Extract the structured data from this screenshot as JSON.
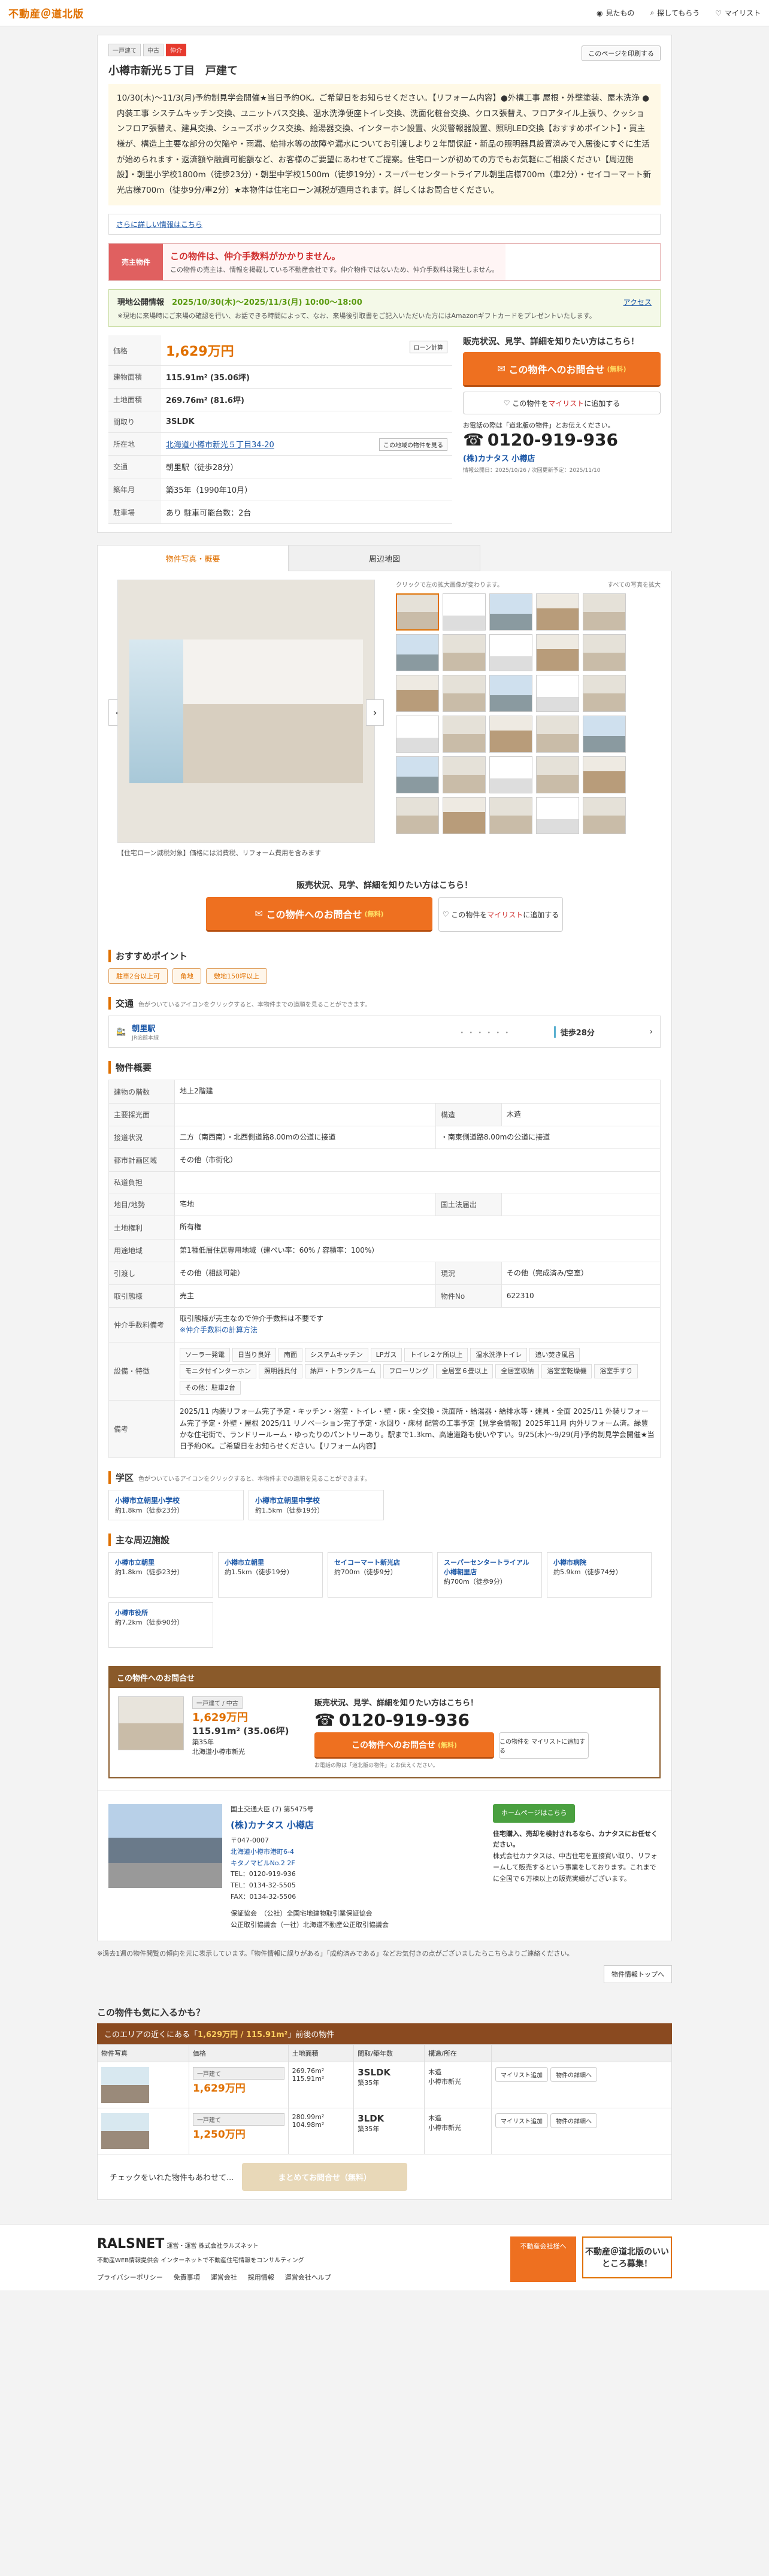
{
  "header": {
    "logo": "不動産＠道北版",
    "nav": [
      "見たもの",
      "探してもらう",
      "マイリスト"
    ]
  },
  "property": {
    "tags": [
      "一戸建て",
      "中古",
      "仲介"
    ],
    "copy_btn": "このページを印刷する",
    "title": "小樽市新光５丁目　戸建て",
    "intro": "10/30(木)〜11/3(月)予約制見学会開催★当日予約OK。ご希望日をお知らせください。【リフォーム内容】●外構工事 屋根・外壁塗装、屋木洗浄 ●内装工事 システムキッチン交換、ユニットバス交換、温水洗浄便座トイレ交換、洗面化粧台交換、クロス張替え、フロアタイル上張り、クッションフロア張替え、建具交換、シューズボックス交換、給湯器交換、インターホン設置、火災警報器設置、照明LED交換【おすすめポイント】・買主様が、構造上主要な部分の欠陥や・雨漏、給排水等の故障や漏水についてお引渡しより２年間保証・新品の照明器具設置済みで入居後にすぐに生活が始められます・返済額や融資可能額など、お客様のご要望にあわせてご提案。住宅ローンが初めての方でもお気軽にご相談ください【周辺施設】・朝里小学校1800m（徒歩23分）・朝里中学校1500m（徒歩19分）・スーパーセンタートライアル朝里店様700m（車2分）・セイコーマート新光店様700m（徒歩9分/車2分）★本物件は住宅ローン減税が適用されます。詳しくはお問合せください。",
    "more_link": "さらに詳しい情報はこちら",
    "notice_label": "売主物件",
    "notice_t1": "この物件は、仲介手数料がかかりません。",
    "notice_t2": "この物件の売主は、情報を掲載している不動産会社です。仲介物件ではないため、仲介手数料は発生しません。",
    "openhouse_t1a": "現地公開情報",
    "openhouse_t1b": "2025/10/30(木)〜2025/11/3(月) 10:00〜18:00",
    "openhouse_t2": "※現地に来場時にご来場の確認を行い、お話できる時間によって、なお、来場後引取書をご記入いただいた方にはAmazonギフトカードをプレゼントいたします。",
    "openhouse_access": "アクセス",
    "specs": {
      "price_label": "価格",
      "price": "1,629万円",
      "loan_btn": "ローン計算",
      "building_label": "建物面積",
      "building": "115.91m² (35.06坪)",
      "land_label": "土地面積",
      "land": "269.76m² (81.6坪)",
      "layout_label": "間取り",
      "layout": "3SLDK",
      "addr_label": "所在地",
      "addr": "北海道小樽市新光５丁目34-20",
      "map_btn": "この地域の物件を見る",
      "traffic_label": "交通",
      "traffic": "朝里駅（徒歩28分）",
      "age_label": "築年月",
      "age": "築35年（1990年10月）",
      "parking_label": "駐車場",
      "parking": "あり 駐車可能台数：2台"
    }
  },
  "cta": {
    "title": "販売状況、見学、詳細を知りたい方はこちら！",
    "inquiry": "この物件へのお問合せ",
    "free": "(無料)",
    "watch_pre": "この物件を",
    "watch_hl": "マイリスト",
    "watch_post": "に追加する",
    "tel_note": "お電話の際は「道北版の物件」とお伝えください。",
    "tel": "0120-919-936",
    "company": "(株)カナタス 小樽店",
    "update": "情報公開日：2025/10/26 / 次回更新予定：2025/11/10"
  },
  "tabs": [
    "物件写真・概要",
    "周辺地図"
  ],
  "photos": {
    "hint": "クリックで左の拡大画像が変わります。",
    "expand": "すべての写真を拡大",
    "caption": "【住宅ローン減税対象】価格には消費税、リフォーム費用を含みます"
  },
  "points": {
    "title": "おすすめポイント",
    "items": [
      "駐車2台以上可",
      "角地",
      "敷地150坪以上"
    ]
  },
  "transport": {
    "title": "交通",
    "note": "色がついているアイコンをクリックすると、本物件までの道順を見ることができます。",
    "station": "朝里駅",
    "line": "JR函館本線",
    "walk": "徒歩28分"
  },
  "overview": {
    "title": "物件概要",
    "rows": [
      [
        "建物の階数",
        "地上2階建"
      ],
      [
        "主要採光面",
        ""
      ],
      [
        "構造",
        "木造"
      ],
      [
        "接道状況",
        "二方（南西南）・北西側道路8.00mの公道に接道"
      ],
      [
        "接道2",
        "・南東側道路8.00mの公道に接道"
      ],
      [
        "都市計画区域",
        "その他（市街化）"
      ],
      [
        "私道負担",
        ""
      ],
      [
        "地目/地勢",
        "宅地"
      ],
      [
        "国土法届出",
        ""
      ],
      [
        "土地権利",
        "所有権"
      ],
      [
        "用途地域",
        "第1種低層住居専用地域（建ぺい率：60% / 容積率：100%）"
      ],
      [
        "引渡し",
        "その他（相談可能）"
      ],
      [
        "現況",
        "その他（完成済み/空室）"
      ],
      [
        "取引態様",
        "売主"
      ],
      [
        "物件No",
        "622310"
      ],
      [
        "仲介手数料備考",
        "取引態様が売主なので仲介手数料は不要です"
      ],
      [
        "仲介手数料link",
        "※仲介手数料の計算方法"
      ],
      [
        "設備・特徴",
        ""
      ],
      [
        "備考",
        "2025/11 内装リフォーム完了予定・キッチン・浴室・トイレ・壁・床・全交換・洗面所・給湯器・給排水等・建具・全面 2025/11 外装リフォーム完了予定・外壁・屋根 2025/11 リノベーション完了予定・水回り・床材 配管の工事予定【見学会情報】2025年11月 内外リフォーム済。緑豊かな住宅街で、ランドリールーム・ゆったりのパントリーあり。駅まで1.3km、高速道路も使いやすい。9/25(木)〜9/29(月)予約制見学会開催★当日予約OK。ご希望日をお知らせください。【リフォーム内容】"
      ]
    ],
    "equip": [
      "ソーラー発電",
      "日当り良好",
      "南面",
      "システムキッチン",
      "LPガス",
      "トイレ２ケ所以上",
      "温水洗浄トイレ",
      "追い焚き風呂",
      "モニタ付インターホン",
      "照明器具付",
      "納戸・トランクルーム",
      "フローリング",
      "全居室６畳以上",
      "全居室収納",
      "浴室室乾燥機",
      "浴室手すり",
      "その他：駐車2台"
    ]
  },
  "schools": {
    "title": "学区",
    "note": "色がついているアイコンをクリックすると、本物件までの道順を見ることができます。",
    "items": [
      {
        "name": "小樽市立朝里小学校",
        "dist": "約1.8km（徒歩23分）"
      },
      {
        "name": "小樽市立朝里中学校",
        "dist": "約1.5km（徒歩19分）"
      }
    ]
  },
  "facilities": {
    "title": "主な周辺施設",
    "items": [
      {
        "name": "小樽市立朝里",
        "dist": "約1.8km（徒歩23分）"
      },
      {
        "name": "小樽市立朝里",
        "dist": "約1.5km（徒歩19分）"
      },
      {
        "name": "セイコーマート新光店",
        "dist": "約700m（徒歩9分）"
      },
      {
        "name": "スーパーセンタートライアル小樽朝里店",
        "dist": "約700m（徒歩9分）"
      },
      {
        "name": "小樽市病院",
        "dist": "約5.9km（徒歩74分）"
      },
      {
        "name": "小樽市役所",
        "dist": "約7.2km（徒歩90分）"
      }
    ]
  },
  "inquiry": {
    "head": "この物件へのお問合せ",
    "tag": "一戸建て / 中古",
    "price": "1,629万円",
    "area": "115.91m² (35.06坪)",
    "age": "築35年",
    "addr": "北海道小樽市新光",
    "ttl": "販売状況、見学、詳細を知りたい方はこちら！",
    "tel": "0120-919-936",
    "tel_note": "お電話の際は「道北版の物件」とお伝えください。",
    "btn": "この物件へのお問合せ",
    "free": "(無料)",
    "watch": "この物件を マイリストに追加する"
  },
  "agent": {
    "license": "国土交通大臣 (7) 第5475号",
    "name": "(株)カナタス 小樽店",
    "hp": "ホームページはこちら",
    "info": [
      "〒047-0007",
      "北海道小樽市港町6-4",
      "キタノマビルNo.2 2F",
      "TEL：0120-919-936",
      "TEL：0134-32-5505",
      "FAX：0134-32-5506"
    ],
    "desc_h": "住宅購入、売却を検討されるなら、カナタスにお任せください。",
    "desc": "株式会社カナタスは、中古住宅を直接買い取り、リフォームして販売するという事業をしております。これまでに全国で６万棟以上の販売実績がございます。",
    "assoc": [
      "保証協会　（公社）全国宅地建物取引業保証協会",
      "公正取引協議会（一社）北海道不動産公正取引協議会"
    ]
  },
  "footnote": "※過去1週の物件閲覧の傾向を元に表示しています。「物件情報に誤りがある」「成約済みである」などお気付きの点がございましたらこちらよりご連絡ください。",
  "pagetop": "物件情報トップへ",
  "similar": {
    "title": "この物件も気に入るかも？",
    "bar_pre": "このエリアの近くにある「",
    "bar_b": "1,629万円 / 115.91m²",
    "bar_post": "」前後の物件",
    "cols": [
      "物件写真",
      "価格",
      "土地面積",
      "間取/築年数",
      "構造/所在",
      ""
    ],
    "rows": [
      {
        "tag": "一戸建て",
        "price": "1,629万円",
        "land": "269.76m²",
        "bld": "115.91m²",
        "layout": "3SLDK",
        "age": "築35年",
        "struct": "木造",
        "loc": "小樽市新光",
        "btn1": "マイリスト追加",
        "btn2": "物件の詳細へ"
      },
      {
        "tag": "一戸建て",
        "price": "1,250万円",
        "land": "280.99m²",
        "bld": "104.98m²",
        "layout": "3LDK",
        "age": "築35年",
        "struct": "木造",
        "loc": "小樽市新光",
        "btn1": "マイリスト追加",
        "btn2": "物件の詳細へ"
      }
    ],
    "bulk_text": "チェックをいれた物件もあわせて...",
    "bulk_btn": "まとめてお問合せ（無料）"
  },
  "footer": {
    "brand": "RALSNET",
    "op": "運営・運営 株式会社ラルズネット",
    "lines": "不動産WEB情報提供会 インターネットで不動産住宅情報をコンサルティング",
    "links": [
      "プライバシーポリシー",
      "免責事項",
      "運営会社",
      "採用情報",
      "運営会社ヘルプ"
    ],
    "badge": "不動産会社様へ",
    "banner": "不動産＠道北版のいいところ募集！"
  }
}
